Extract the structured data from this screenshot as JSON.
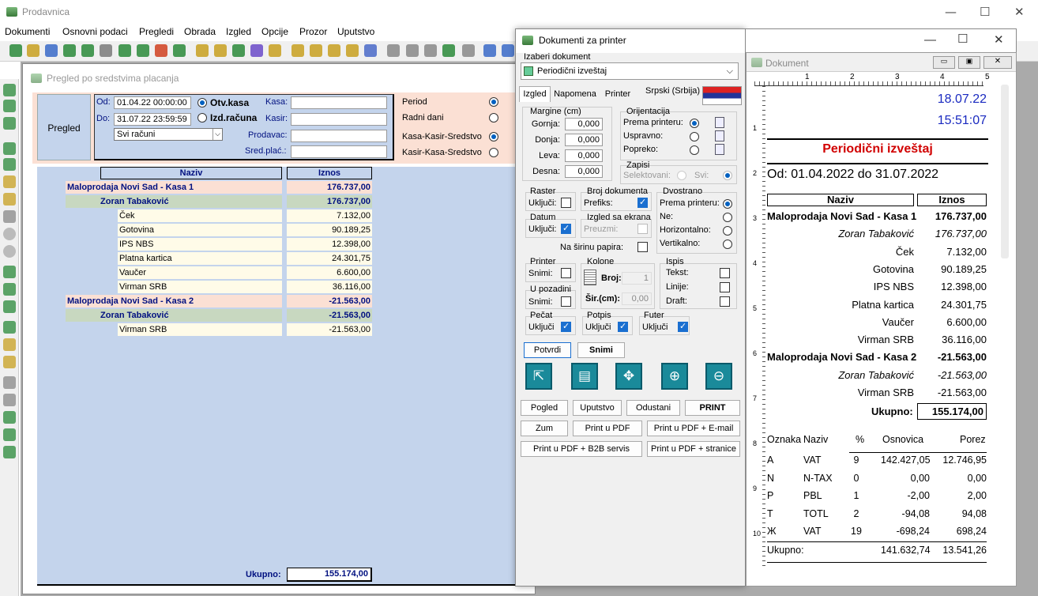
{
  "app": {
    "title": "Prodavnica",
    "menu": [
      "Dokumenti",
      "Osnovni podaci",
      "Pregledi",
      "Obrada",
      "Izgled",
      "Opcije",
      "Prozor",
      "Uputstvo"
    ]
  },
  "child": {
    "title": "Pregled po sredstvima placanja",
    "pregled_label": "Pregled",
    "od_label": "Od:",
    "od_value": "01.04.22 00:00:00",
    "do_label": "Do:",
    "do_value": "31.07.22 23:59:59",
    "otv_kasa": "Otv.kasa",
    "izd_racuna": "Izd.računa",
    "svi_racuni": "Svi računi",
    "kasa_label": "Kasa:",
    "kasir_label": "Kasir:",
    "prodavac_label": "Prodavac:",
    "sred_label": "Sred.plać.:",
    "period_opts": [
      "Period",
      "Radni dani",
      "Kasa-Kasir-Sredstvo",
      "Kasir-Kasa-Sredstvo"
    ],
    "grid_headers": [
      "Naziv",
      "Iznos"
    ],
    "rows": [
      {
        "name": "Maloprodaja Novi Sad - Kasa 1",
        "amount": "176.737,00",
        "level": "kasa"
      },
      {
        "name": "Zoran Tabaković",
        "amount": "176.737,00",
        "level": "kasir"
      },
      {
        "name": "Ček",
        "amount": "7.132,00",
        "level": "item"
      },
      {
        "name": "Gotovina",
        "amount": "90.189,25",
        "level": "item"
      },
      {
        "name": "IPS NBS",
        "amount": "12.398,00",
        "level": "item"
      },
      {
        "name": "Platna kartica",
        "amount": "24.301,75",
        "level": "item"
      },
      {
        "name": "Vaučer",
        "amount": "6.600,00",
        "level": "item"
      },
      {
        "name": "Virman SRB",
        "amount": "36.116,00",
        "level": "item"
      },
      {
        "name": "Maloprodaja Novi Sad - Kasa 2",
        "amount": "-21.563,00",
        "level": "kasa"
      },
      {
        "name": "Zoran Tabaković",
        "amount": "-21.563,00",
        "level": "kasir"
      },
      {
        "name": "Virman SRB",
        "amount": "-21.563,00",
        "level": "item"
      }
    ],
    "ukupno_label": "Ukupno:",
    "ukupno_value": "155.174,00"
  },
  "dialog": {
    "title": "Dokumenti za printer",
    "izaberi": "Izaberi dokument",
    "dokument": "Periodični izveštaj",
    "tabs": [
      "Izgled",
      "Napomena",
      "Printer"
    ],
    "lang": "Srpski (Srbija)",
    "margine": "Margine (cm)",
    "margins": [
      {
        "l": "Gornja:",
        "v": "0,000"
      },
      {
        "l": "Donja:",
        "v": "0,000"
      },
      {
        "l": "Leva:",
        "v": "0,000"
      },
      {
        "l": "Desna:",
        "v": "0,000"
      }
    ],
    "orijentacija": "Orijentacija",
    "orient": [
      "Prema printeru:",
      "Uspravno:",
      "Popreko:"
    ],
    "zapisi": "Zapisi",
    "selektovani": "Selektovani:",
    "svi": "Svi:",
    "raster": "Raster",
    "ukljuci": "Uključi:",
    "broj_dok": "Broj dokumenta",
    "prefiks": "Prefiks:",
    "dvostrano": "Dvostrano",
    "dvo": [
      "Prema printeru:",
      "Ne:",
      "Horizontalno:",
      "Vertikalno:"
    ],
    "datum": "Datum",
    "izgled_ekr": "Izgled sa ekrana",
    "preuzmi": "Preuzmi:",
    "na_sirinu": "Na širinu papira:",
    "printer": "Printer",
    "snimi_l": "Snimi:",
    "kolone": "Kolone",
    "broj_l": "Broj:",
    "broj_v": "1",
    "sir_l": "Šir.(cm):",
    "sir_v": "0,00",
    "ispis": "Ispis",
    "ispis_opts": [
      "Tekst:",
      "Linije:",
      "Draft:"
    ],
    "u_pozadini": "U pozadini",
    "pecat": "Pečat",
    "potpis": "Potpis",
    "futer": "Futer",
    "ukljuci2": "Uključi",
    "potvrdi": "Potvrdi",
    "snimi": "Snimi",
    "btn_row1": [
      "Pogled",
      "Uputstvo",
      "Odustani",
      "PRINT"
    ],
    "btn_row2": [
      "Zum",
      "Print u PDF",
      "Print u PDF + E-mail"
    ],
    "btn_row3": [
      "Print u PDF + B2B servis",
      "Print u PDF + stranice"
    ]
  },
  "preview": {
    "title": "Dokument",
    "date": "18.07.22",
    "time": "15:51:07",
    "heading": "Periodični izveštaj",
    "range": "Od: 01.04.2022 do 31.07.2022",
    "headers": [
      "Naziv",
      "Iznos"
    ],
    "rows": [
      {
        "name": "Maloprodaja Novi Sad - Kasa 1",
        "amount": "176.737,00",
        "style": "bold"
      },
      {
        "name": "Zoran Tabaković",
        "amount": "176.737,00",
        "style": "italic"
      },
      {
        "name": "Ček",
        "amount": "7.132,00",
        "style": "normal"
      },
      {
        "name": "Gotovina",
        "amount": "90.189,25",
        "style": "normal"
      },
      {
        "name": "IPS NBS",
        "amount": "12.398,00",
        "style": "normal"
      },
      {
        "name": "Platna kartica",
        "amount": "24.301,75",
        "style": "normal"
      },
      {
        "name": "Vaučer",
        "amount": "6.600,00",
        "style": "normal"
      },
      {
        "name": "Virman SRB",
        "amount": "36.116,00",
        "style": "normal"
      },
      {
        "name": "Maloprodaja Novi Sad - Kasa 2",
        "amount": "-21.563,00",
        "style": "bold"
      },
      {
        "name": "Zoran Tabaković",
        "amount": "-21.563,00",
        "style": "italic"
      },
      {
        "name": "Virman SRB",
        "amount": "-21.563,00",
        "style": "normal"
      }
    ],
    "ukupno_label": "Ukupno:",
    "ukupno_value": "155.174,00",
    "tax_headers": [
      "Oznaka",
      "Naziv",
      "%",
      "Osnovica",
      "Porez"
    ],
    "tax_rows": [
      [
        "A",
        "VAT",
        "9",
        "142.427,05",
        "12.746,95"
      ],
      [
        "N",
        "N-TAX",
        "0",
        "0,00",
        "0,00"
      ],
      [
        "P",
        "PBL",
        "1",
        "-2,00",
        "2,00"
      ],
      [
        "T",
        "TOTL",
        "2",
        "-94,08",
        "94,08"
      ],
      [
        "Ж",
        "VAT",
        "19",
        "-698,24",
        "698,24"
      ]
    ],
    "tax_total": [
      "Ukupno:",
      "141.632,74",
      "13.541,26"
    ],
    "ruler_nums": [
      "1",
      "2",
      "3",
      "4",
      "5"
    ],
    "vruler_nums": [
      "1",
      "2",
      "3",
      "4",
      "5",
      "6",
      "7",
      "8",
      "9",
      "10"
    ]
  }
}
